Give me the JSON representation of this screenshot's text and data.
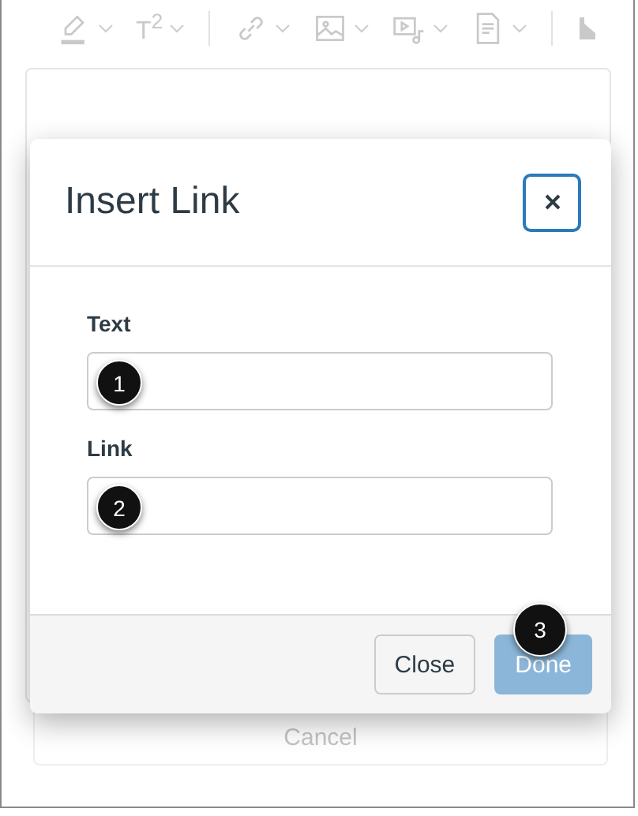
{
  "toolbar": {
    "items": [
      {
        "kind": "highlighter"
      },
      {
        "kind": "superscript",
        "label": "T$^{2}$"
      },
      {
        "kind": "divider"
      },
      {
        "kind": "link"
      },
      {
        "kind": "image"
      },
      {
        "kind": "media"
      },
      {
        "kind": "document"
      },
      {
        "kind": "divider"
      },
      {
        "kind": "direction"
      }
    ]
  },
  "dialog": {
    "title": "Insert Link",
    "fields": [
      {
        "label": "Text",
        "step": "1"
      },
      {
        "label": "Link",
        "step": "2"
      }
    ],
    "buttons": [
      {
        "label": "Close",
        "disabled": false
      },
      {
        "label": "Done",
        "disabled": true,
        "step": "3"
      }
    ]
  },
  "cancel_button": "Cancel"
}
